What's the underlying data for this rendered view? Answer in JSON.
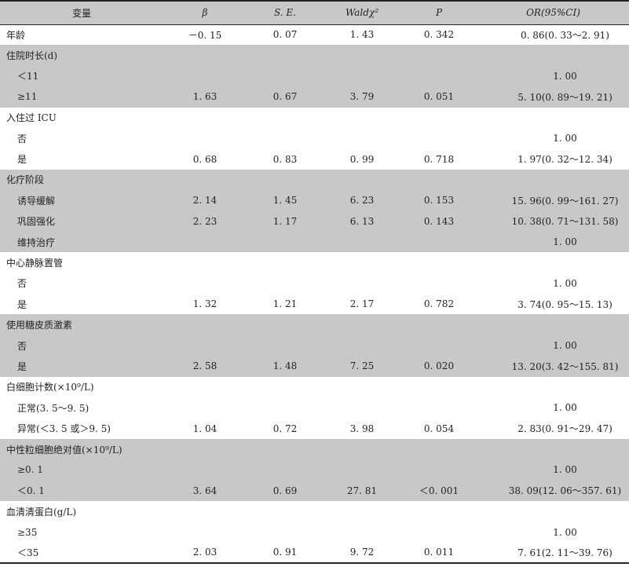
{
  "header": {
    "variable": "变量",
    "beta": "β",
    "se": "S. E.",
    "wald": "Waldχ²",
    "p": "P",
    "or": "OR(95%CI)"
  },
  "rows": [
    {
      "label": "年龄",
      "beta": "－0. 15",
      "se": "0. 07",
      "wald": "1. 43",
      "p": "0. 342",
      "or": "0. 86(0. 33～2. 91)"
    },
    {
      "label": "住院时长(d)",
      "beta": "",
      "se": "",
      "wald": "",
      "p": "",
      "or": ""
    },
    {
      "label": "＜11",
      "beta": "",
      "se": "",
      "wald": "",
      "p": "",
      "or": "1. 00"
    },
    {
      "label": "≥11",
      "beta": "1. 63",
      "se": "0. 67",
      "wald": "3. 79",
      "p": "0. 051",
      "or": "5. 10(0. 89～19. 21)"
    },
    {
      "label": "入住过 ICU",
      "beta": "",
      "se": "",
      "wald": "",
      "p": "",
      "or": ""
    },
    {
      "label": "否",
      "beta": "",
      "se": "",
      "wald": "",
      "p": "",
      "or": "1. 00"
    },
    {
      "label": "是",
      "beta": "0. 68",
      "se": "0. 83",
      "wald": "0. 99",
      "p": "0. 718",
      "or": "1. 97(0. 32～12. 34)"
    },
    {
      "label": "化疗阶段",
      "beta": "",
      "se": "",
      "wald": "",
      "p": "",
      "or": ""
    },
    {
      "label": "诱导缓解",
      "beta": "2. 14",
      "se": "1. 45",
      "wald": "6. 23",
      "p": "0. 153",
      "or": "15. 96(0. 99～161. 27)"
    },
    {
      "label": "巩固强化",
      "beta": "2. 23",
      "se": "1. 17",
      "wald": "6. 13",
      "p": "0. 143",
      "or": "10. 38(0. 71～131. 58)"
    },
    {
      "label": "维持治疗",
      "beta": "",
      "se": "",
      "wald": "",
      "p": "",
      "or": "1. 00"
    },
    {
      "label": "中心静脉置管",
      "beta": "",
      "se": "",
      "wald": "",
      "p": "",
      "or": ""
    },
    {
      "label": "否",
      "beta": "",
      "se": "",
      "wald": "",
      "p": "",
      "or": "1. 00"
    },
    {
      "label": "是",
      "beta": "1. 32",
      "se": "1. 21",
      "wald": "2. 17",
      "p": "0. 782",
      "or": "3. 74(0. 95～15. 13)"
    },
    {
      "label": "使用糖皮质激素",
      "beta": "",
      "se": "",
      "wald": "",
      "p": "",
      "or": ""
    },
    {
      "label": "否",
      "beta": "",
      "se": "",
      "wald": "",
      "p": "",
      "or": "1. 00"
    },
    {
      "label": "是",
      "beta": "2. 58",
      "se": "1. 48",
      "wald": "7. 25",
      "p": "0. 020",
      "or": "13. 20(3. 42～155. 81)"
    },
    {
      "label": "白细胞计数(×10⁹/L)",
      "beta": "",
      "se": "",
      "wald": "",
      "p": "",
      "or": ""
    },
    {
      "label": "正常(3. 5～9. 5)",
      "beta": "",
      "se": "",
      "wald": "",
      "p": "",
      "or": "1. 00"
    },
    {
      "label": "异常(＜3. 5 或＞9. 5)",
      "beta": "1. 04",
      "se": "0. 72",
      "wald": "3. 98",
      "p": "0. 054",
      "or": "2. 83(0. 91～29. 47)"
    },
    {
      "label": "中性粒细胞绝对值(×10⁹/L)",
      "beta": "",
      "se": "",
      "wald": "",
      "p": "",
      "or": ""
    },
    {
      "label": "≥0. 1",
      "beta": "",
      "se": "",
      "wald": "",
      "p": "",
      "or": "1. 00"
    },
    {
      "label": "＜0. 1",
      "beta": "3. 64",
      "se": "0. 69",
      "wald": "27. 81",
      "p": "＜0. 001",
      "or": "38. 09(12. 06～357. 61)"
    },
    {
      "label": "血清清蛋白(g/L)",
      "beta": "",
      "se": "",
      "wald": "",
      "p": "",
      "or": ""
    },
    {
      "label": "≥35",
      "beta": "",
      "se": "",
      "wald": "",
      "p": "",
      "or": "1. 00"
    },
    {
      "label": "＜35",
      "beta": "2. 03",
      "se": "0. 91",
      "wald": "9. 72",
      "p": "0. 011",
      "or": "7. 61(2. 11～39. 76)"
    }
  ]
}
